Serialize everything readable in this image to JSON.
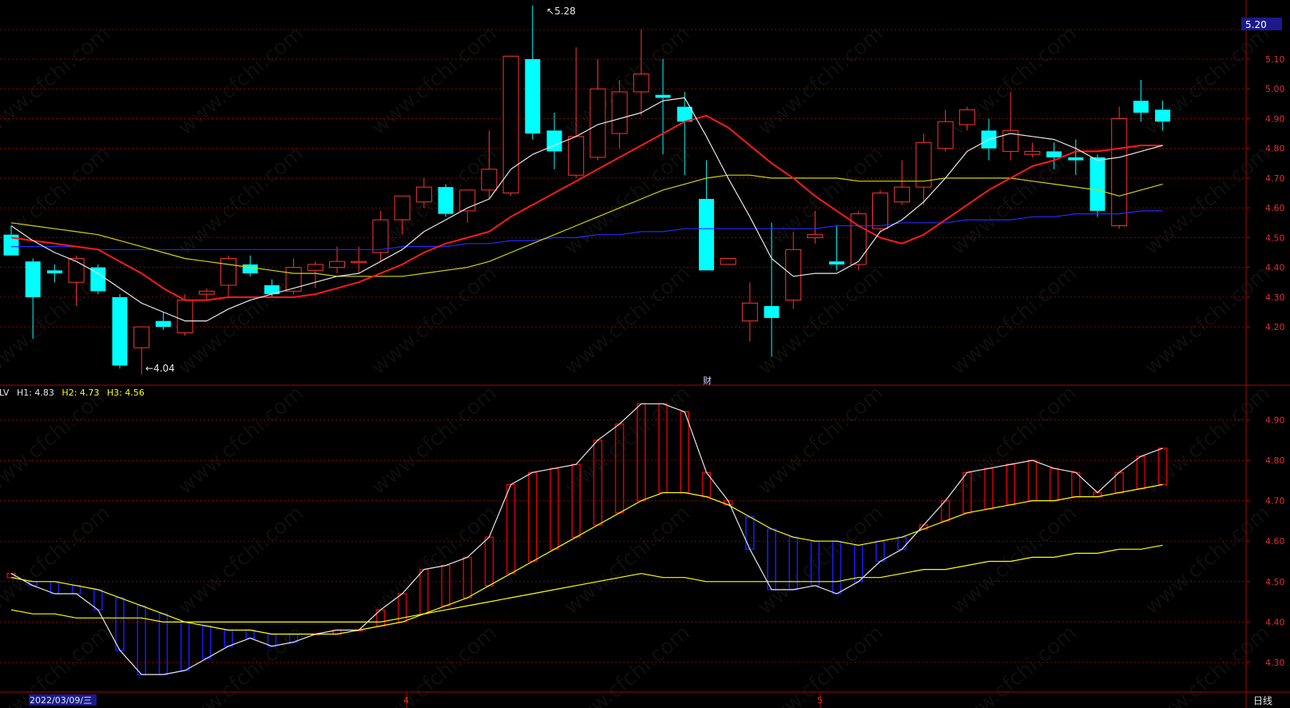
{
  "price_panel": {
    "current_price": "5.20",
    "price_ticks": [
      "5.10",
      "5.00",
      "4.90",
      "4.80",
      "4.70",
      "4.60",
      "4.50",
      "4.40",
      "4.30",
      "4.20"
    ],
    "high_marker": "5.28",
    "low_marker": "4.04",
    "event_marker": "财"
  },
  "indicator_panel": {
    "name_fragment": "LV",
    "h1_label": "H1: 4.83",
    "h2_label": "H2: 4.73",
    "h3_label": "H3: 4.56",
    "ticks": [
      "4.90",
      "4.80",
      "4.70",
      "4.60",
      "4.50",
      "4.40",
      "4.30"
    ]
  },
  "time_axis": {
    "start_date": "2022/03/09/三",
    "month_labels": [
      "4",
      "5"
    ],
    "period_label": "日线"
  },
  "watermark": "www.cfchi.com",
  "colors": {
    "up": "#ff3232",
    "down": "#00ffff",
    "ma_white": "#e8e8e8",
    "ma_red": "#ff1a1a",
    "ma_yellow": "#d4d400",
    "ma_blue": "#2828ff",
    "grid": "#8b0000",
    "axis_text": "#e03030",
    "h1": "#e8e8e8",
    "h2": "#ffff00",
    "h3": "#ffff00",
    "hist_up": "#d40000",
    "hist_down": "#1a1aff"
  },
  "chart_data": [
    {
      "type": "candlestick",
      "ylim": [
        4.0,
        5.3
      ],
      "candles": [
        {
          "o": 4.51,
          "h": 4.54,
          "l": 4.44,
          "c": 4.44
        },
        {
          "o": 4.42,
          "h": 4.43,
          "l": 4.16,
          "c": 4.3
        },
        {
          "o": 4.39,
          "h": 4.41,
          "l": 4.35,
          "c": 4.38
        },
        {
          "o": 4.35,
          "h": 4.44,
          "l": 4.27,
          "c": 4.43
        },
        {
          "o": 4.4,
          "h": 4.41,
          "l": 4.31,
          "c": 4.32
        },
        {
          "o": 4.3,
          "h": 4.31,
          "l": 4.06,
          "c": 4.07
        },
        {
          "o": 4.13,
          "h": 4.2,
          "l": 4.04,
          "c": 4.2
        },
        {
          "o": 4.22,
          "h": 4.25,
          "l": 4.19,
          "c": 4.2
        },
        {
          "o": 4.18,
          "h": 4.31,
          "l": 4.17,
          "c": 4.29
        },
        {
          "o": 4.31,
          "h": 4.33,
          "l": 4.29,
          "c": 4.32
        },
        {
          "o": 4.34,
          "h": 4.44,
          "l": 4.3,
          "c": 4.43
        },
        {
          "o": 4.41,
          "h": 4.44,
          "l": 4.37,
          "c": 4.38
        },
        {
          "o": 4.34,
          "h": 4.36,
          "l": 4.3,
          "c": 4.31
        },
        {
          "o": 4.32,
          "h": 4.43,
          "l": 4.31,
          "c": 4.4
        },
        {
          "o": 4.39,
          "h": 4.42,
          "l": 4.33,
          "c": 4.41
        },
        {
          "o": 4.4,
          "h": 4.47,
          "l": 4.38,
          "c": 4.42
        },
        {
          "o": 4.42,
          "h": 4.47,
          "l": 4.38,
          "c": 4.42
        },
        {
          "o": 4.45,
          "h": 4.59,
          "l": 4.42,
          "c": 4.56
        },
        {
          "o": 4.56,
          "h": 4.63,
          "l": 4.51,
          "c": 4.64
        },
        {
          "o": 4.62,
          "h": 4.7,
          "l": 4.6,
          "c": 4.67
        },
        {
          "o": 4.67,
          "h": 4.68,
          "l": 4.57,
          "c": 4.58
        },
        {
          "o": 4.59,
          "h": 4.65,
          "l": 4.55,
          "c": 4.66
        },
        {
          "o": 4.66,
          "h": 4.86,
          "l": 4.63,
          "c": 4.73
        },
        {
          "o": 4.65,
          "h": 5.11,
          "l": 4.64,
          "c": 5.11
        },
        {
          "o": 5.1,
          "h": 5.28,
          "l": 4.83,
          "c": 4.85
        },
        {
          "o": 4.86,
          "h": 4.92,
          "l": 4.73,
          "c": 4.79
        },
        {
          "o": 4.71,
          "h": 5.14,
          "l": 4.7,
          "c": 4.84
        },
        {
          "o": 4.77,
          "h": 5.1,
          "l": 4.76,
          "c": 5.0
        },
        {
          "o": 4.85,
          "h": 5.03,
          "l": 4.8,
          "c": 4.99
        },
        {
          "o": 4.99,
          "h": 5.2,
          "l": 4.91,
          "c": 5.05
        },
        {
          "o": 4.98,
          "h": 5.1,
          "l": 4.78,
          "c": 4.97
        },
        {
          "o": 4.94,
          "h": 4.99,
          "l": 4.71,
          "c": 4.89
        },
        {
          "o": 4.63,
          "h": 4.76,
          "l": 4.4,
          "c": 4.39
        },
        {
          "o": 4.41,
          "h": 4.43,
          "l": 4.41,
          "c": 4.43
        },
        {
          "o": 4.22,
          "h": 4.35,
          "l": 4.15,
          "c": 4.28
        },
        {
          "o": 4.27,
          "h": 4.55,
          "l": 4.1,
          "c": 4.23
        },
        {
          "o": 4.29,
          "h": 4.52,
          "l": 4.26,
          "c": 4.46
        },
        {
          "o": 4.5,
          "h": 4.59,
          "l": 4.48,
          "c": 4.51
        },
        {
          "o": 4.42,
          "h": 4.54,
          "l": 4.39,
          "c": 4.41
        },
        {
          "o": 4.41,
          "h": 4.59,
          "l": 4.39,
          "c": 4.58
        },
        {
          "o": 4.53,
          "h": 4.66,
          "l": 4.52,
          "c": 4.65
        },
        {
          "o": 4.62,
          "h": 4.76,
          "l": 4.61,
          "c": 4.67
        },
        {
          "o": 4.67,
          "h": 4.85,
          "l": 4.61,
          "c": 4.82
        },
        {
          "o": 4.8,
          "h": 4.93,
          "l": 4.79,
          "c": 4.89
        },
        {
          "o": 4.88,
          "h": 4.94,
          "l": 4.86,
          "c": 4.93
        },
        {
          "o": 4.86,
          "h": 4.9,
          "l": 4.76,
          "c": 4.8
        },
        {
          "o": 4.79,
          "h": 4.99,
          "l": 4.76,
          "c": 4.86
        },
        {
          "o": 4.78,
          "h": 4.82,
          "l": 4.77,
          "c": 4.79
        },
        {
          "o": 4.79,
          "h": 4.82,
          "l": 4.73,
          "c": 4.77
        },
        {
          "o": 4.77,
          "h": 4.83,
          "l": 4.71,
          "c": 4.76
        },
        {
          "o": 4.77,
          "h": 4.78,
          "l": 4.57,
          "c": 4.59
        },
        {
          "o": 4.54,
          "h": 4.94,
          "l": 4.53,
          "c": 4.9
        },
        {
          "o": 4.96,
          "h": 5.03,
          "l": 4.89,
          "c": 4.92
        },
        {
          "o": 4.93,
          "h": 4.96,
          "l": 4.86,
          "c": 4.89
        }
      ],
      "ma_white": [
        4.54,
        4.49,
        4.45,
        4.42,
        4.38,
        4.33,
        4.28,
        4.25,
        4.22,
        4.22,
        4.26,
        4.29,
        4.31,
        4.33,
        4.35,
        4.37,
        4.38,
        4.42,
        4.46,
        4.52,
        4.56,
        4.6,
        4.63,
        4.73,
        4.78,
        4.81,
        4.84,
        4.88,
        4.9,
        4.92,
        4.96,
        4.97,
        4.84,
        4.7,
        4.57,
        4.43,
        4.37,
        4.38,
        4.38,
        4.42,
        4.52,
        4.56,
        4.62,
        4.7,
        4.79,
        4.83,
        4.85,
        4.84,
        4.83,
        4.8,
        4.76,
        4.77,
        4.79,
        4.81
      ],
      "ma_red": [
        4.5,
        4.49,
        4.48,
        4.47,
        4.46,
        4.42,
        4.38,
        4.33,
        4.29,
        4.29,
        4.3,
        4.3,
        4.3,
        4.3,
        4.31,
        4.33,
        4.35,
        4.38,
        4.41,
        4.45,
        4.48,
        4.5,
        4.52,
        4.57,
        4.61,
        4.65,
        4.69,
        4.73,
        4.77,
        4.81,
        4.85,
        4.89,
        4.91,
        4.87,
        4.81,
        4.75,
        4.7,
        4.64,
        4.59,
        4.54,
        4.5,
        4.48,
        4.51,
        4.56,
        4.61,
        4.66,
        4.7,
        4.74,
        4.76,
        4.79,
        4.79,
        4.8,
        4.81,
        4.81
      ],
      "ma_yellow": [
        4.55,
        4.54,
        4.53,
        4.52,
        4.51,
        4.49,
        4.47,
        4.45,
        4.43,
        4.42,
        4.41,
        4.4,
        4.39,
        4.38,
        4.38,
        4.37,
        4.37,
        4.37,
        4.37,
        4.38,
        4.39,
        4.4,
        4.42,
        4.45,
        4.48,
        4.51,
        4.54,
        4.57,
        4.6,
        4.63,
        4.66,
        4.68,
        4.7,
        4.71,
        4.71,
        4.7,
        4.7,
        4.7,
        4.7,
        4.69,
        4.69,
        4.69,
        4.69,
        4.7,
        4.7,
        4.7,
        4.7,
        4.69,
        4.68,
        4.67,
        4.66,
        4.64,
        4.66,
        4.68
      ],
      "ma_blue": [
        4.47,
        4.47,
        4.47,
        4.47,
        4.46,
        4.46,
        4.46,
        4.46,
        4.46,
        4.46,
        4.46,
        4.46,
        4.46,
        4.46,
        4.46,
        4.46,
        4.46,
        4.46,
        4.47,
        4.47,
        4.47,
        4.48,
        4.48,
        4.49,
        4.49,
        4.5,
        4.5,
        4.51,
        4.51,
        4.52,
        4.52,
        4.53,
        4.53,
        4.53,
        4.53,
        4.53,
        4.53,
        4.53,
        4.54,
        4.54,
        4.54,
        4.55,
        4.55,
        4.55,
        4.56,
        4.56,
        4.56,
        4.57,
        4.57,
        4.58,
        4.58,
        4.58,
        4.59,
        4.59
      ]
    },
    {
      "type": "line",
      "ylim": [
        4.27,
        4.97
      ],
      "series": [
        {
          "name": "H1",
          "values": [
            4.52,
            4.49,
            4.47,
            4.47,
            4.43,
            4.33,
            4.27,
            4.27,
            4.28,
            4.31,
            4.34,
            4.36,
            4.34,
            4.35,
            4.37,
            4.38,
            4.38,
            4.43,
            4.47,
            4.53,
            4.54,
            4.56,
            4.61,
            4.74,
            4.77,
            4.78,
            4.79,
            4.85,
            4.89,
            4.94,
            4.94,
            4.92,
            4.77,
            4.7,
            4.58,
            4.48,
            4.48,
            4.49,
            4.47,
            4.5,
            4.55,
            4.58,
            4.64,
            4.7,
            4.77,
            4.78,
            4.79,
            4.8,
            4.78,
            4.77,
            4.72,
            4.77,
            4.81,
            4.83
          ]
        },
        {
          "name": "H2",
          "values": [
            4.51,
            4.5,
            4.5,
            4.49,
            4.48,
            4.46,
            4.44,
            4.42,
            4.4,
            4.39,
            4.38,
            4.38,
            4.37,
            4.37,
            4.37,
            4.37,
            4.38,
            4.39,
            4.4,
            4.42,
            4.44,
            4.46,
            4.49,
            4.52,
            4.55,
            4.58,
            4.61,
            4.64,
            4.67,
            4.7,
            4.72,
            4.72,
            4.71,
            4.69,
            4.66,
            4.63,
            4.61,
            4.6,
            4.6,
            4.59,
            4.6,
            4.61,
            4.63,
            4.65,
            4.67,
            4.68,
            4.69,
            4.7,
            4.7,
            4.71,
            4.71,
            4.72,
            4.73,
            4.74
          ]
        },
        {
          "name": "H3",
          "values": [
            4.43,
            4.42,
            4.42,
            4.41,
            4.41,
            4.41,
            4.41,
            4.4,
            4.4,
            4.4,
            4.4,
            4.4,
            4.4,
            4.4,
            4.4,
            4.4,
            4.4,
            4.4,
            4.41,
            4.42,
            4.43,
            4.44,
            4.45,
            4.46,
            4.47,
            4.48,
            4.49,
            4.5,
            4.51,
            4.52,
            4.51,
            4.51,
            4.5,
            4.5,
            4.5,
            4.5,
            4.5,
            4.5,
            4.5,
            4.51,
            4.51,
            4.52,
            4.53,
            4.53,
            4.54,
            4.55,
            4.55,
            4.56,
            4.56,
            4.57,
            4.57,
            4.58,
            4.58,
            4.59
          ]
        }
      ]
    }
  ]
}
